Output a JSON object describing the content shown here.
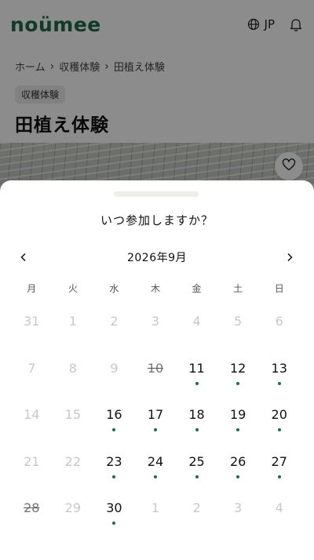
{
  "header": {
    "logo": "noümee",
    "lang_label": "JP",
    "icons": {
      "language": "globe-icon",
      "notifications": "bell-icon"
    }
  },
  "breadcrumb": [
    "ホーム",
    "収穫体験",
    "田植え体験"
  ],
  "category_badge": "収穫体験",
  "page_title": "田植え体験",
  "sheet": {
    "title": "いつ参加しますか？",
    "month_label": "2026年9月",
    "weekdays": [
      "月",
      "火",
      "水",
      "木",
      "金",
      "土",
      "日"
    ],
    "days": [
      {
        "label": "31",
        "state": "muted"
      },
      {
        "label": "1",
        "state": "muted"
      },
      {
        "label": "2",
        "state": "muted"
      },
      {
        "label": "3",
        "state": "muted"
      },
      {
        "label": "4",
        "state": "muted"
      },
      {
        "label": "5",
        "state": "muted"
      },
      {
        "label": "6",
        "state": "muted"
      },
      {
        "label": "7",
        "state": "muted"
      },
      {
        "label": "8",
        "state": "muted"
      },
      {
        "label": "9",
        "state": "muted"
      },
      {
        "label": "10",
        "state": "strike"
      },
      {
        "label": "11",
        "state": "available"
      },
      {
        "label": "12",
        "state": "available"
      },
      {
        "label": "13",
        "state": "available"
      },
      {
        "label": "14",
        "state": "muted"
      },
      {
        "label": "15",
        "state": "muted"
      },
      {
        "label": "16",
        "state": "available"
      },
      {
        "label": "17",
        "state": "available"
      },
      {
        "label": "18",
        "state": "available"
      },
      {
        "label": "19",
        "state": "available"
      },
      {
        "label": "20",
        "state": "available"
      },
      {
        "label": "21",
        "state": "muted"
      },
      {
        "label": "22",
        "state": "muted"
      },
      {
        "label": "23",
        "state": "available"
      },
      {
        "label": "24",
        "state": "available"
      },
      {
        "label": "25",
        "state": "available"
      },
      {
        "label": "26",
        "state": "available"
      },
      {
        "label": "27",
        "state": "available"
      },
      {
        "label": "28",
        "state": "strike"
      },
      {
        "label": "29",
        "state": "muted"
      },
      {
        "label": "30",
        "state": "available"
      },
      {
        "label": "1",
        "state": "muted"
      },
      {
        "label": "2",
        "state": "muted"
      },
      {
        "label": "3",
        "state": "muted"
      },
      {
        "label": "4",
        "state": "muted"
      }
    ]
  },
  "colors": {
    "brand": "#1f6a4a",
    "available_dot": "#1f6a4a",
    "muted_text": "#c8c8c8"
  }
}
